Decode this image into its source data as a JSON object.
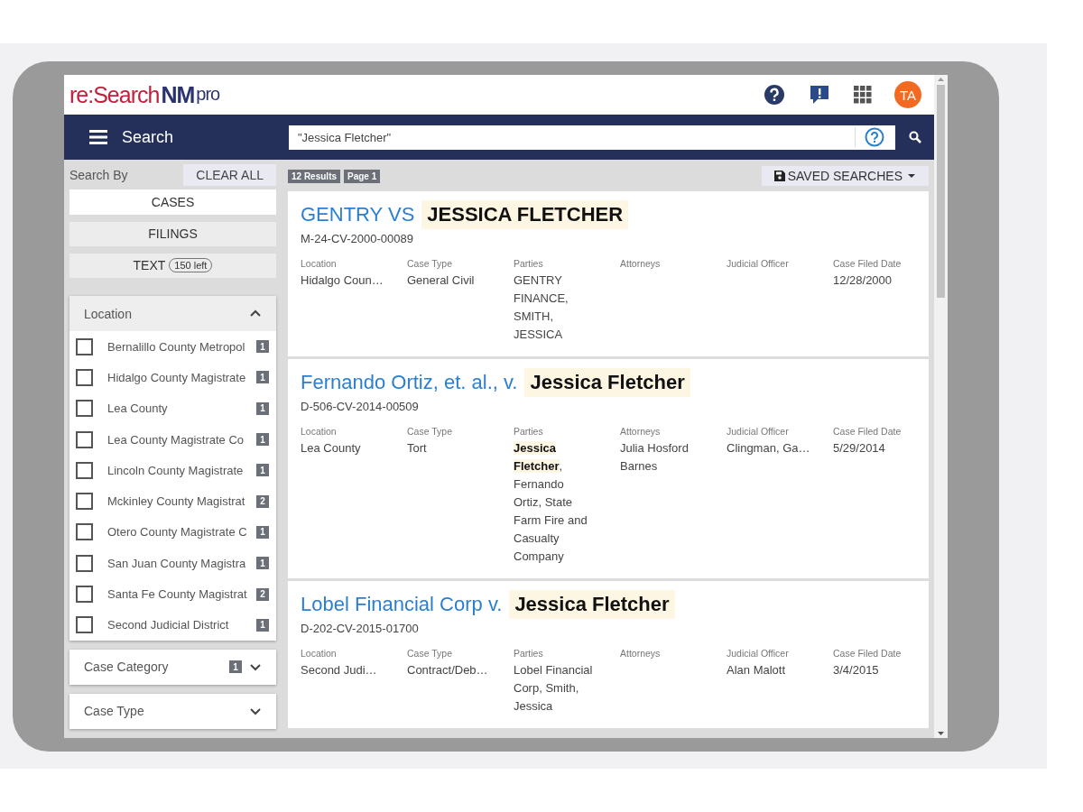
{
  "logo": {
    "part_1": "re:Search",
    "part_2": "NM",
    "part_3": "pro"
  },
  "header": {
    "avatar": "TA"
  },
  "nav": {
    "menu_label": "Search",
    "search": {
      "value": "\"Jessica Fletcher\""
    }
  },
  "sidebar": {
    "search_by_label": "Search By",
    "clear_all": "CLEAR ALL",
    "modes": [
      {
        "label": "CASES",
        "selected": true
      },
      {
        "label": "FILINGS",
        "selected": false
      },
      {
        "label": "TEXT",
        "badge": "150 left",
        "selected": false
      }
    ],
    "filters": [
      {
        "title": "Location",
        "expanded": true,
        "options": [
          {
            "label": "Bernalillo County Metropol",
            "count": "1",
            "checked": false
          },
          {
            "label": "Hidalgo County Magistrate",
            "count": "1",
            "checked": false
          },
          {
            "label": "Lea County",
            "count": "1",
            "checked": false
          },
          {
            "label": "Lea County Magistrate Co",
            "count": "1",
            "checked": false
          },
          {
            "label": "Lincoln County Magistrate",
            "count": "1",
            "checked": false
          },
          {
            "label": "Mckinley County Magistrat",
            "count": "2",
            "checked": false
          },
          {
            "label": "Otero County Magistrate C",
            "count": "1",
            "checked": false
          },
          {
            "label": "San Juan County Magistra",
            "count": "1",
            "checked": false
          },
          {
            "label": "Santa Fe County Magistrat",
            "count": "2",
            "checked": false
          },
          {
            "label": "Second Judicial District",
            "count": "1",
            "checked": false
          }
        ]
      },
      {
        "title": "Case Category",
        "count": "1",
        "expanded": false
      },
      {
        "title": "Case Type",
        "expanded": false
      }
    ]
  },
  "results": {
    "count_badge": "12 Results",
    "page_badge": "Page 1",
    "saved_searches": "SAVED SEARCHES",
    "cases": [
      {
        "title_prefix": "GENTRY VS",
        "title_match": "JESSICA FLETCHER",
        "number": "M-24-CV-2000-00089",
        "fields": [
          {
            "label": "Location",
            "value": "Hidalgo Coun…"
          },
          {
            "label": "Case Type",
            "value": "General Civil"
          },
          {
            "label": "Parties",
            "value": "GENTRY FINANCE, SMITH, JESSICA"
          },
          {
            "label": "Attorneys"
          },
          {
            "label": "Judicial Officer"
          },
          {
            "label": "Case Filed Date",
            "value": "12/28/2000"
          }
        ]
      },
      {
        "title_prefix": "Fernando Ortiz, et. al., v.",
        "title_match": "Jessica Fletcher",
        "number": "D-506-CV-2014-00509",
        "fields": [
          {
            "label": "Location",
            "value": "Lea County"
          },
          {
            "label": "Case Type",
            "value": "Tort"
          },
          {
            "label": "Parties",
            "value": "**Jessica Fletcher**, Fernando Ortiz, State Farm Fire and Casualty Company"
          },
          {
            "label": "Attorneys",
            "value": "Julia Hosford Barnes"
          },
          {
            "label": "Judicial Officer",
            "value": "Clingman, Ga…"
          },
          {
            "label": "Case Filed Date",
            "value": "5/29/2014"
          }
        ]
      },
      {
        "title_prefix": "Lobel Financial Corp v.",
        "title_match": "Jessica Fletcher",
        "number": "D-202-CV-2015-01700",
        "fields": [
          {
            "label": "Location",
            "value": "Second Judi…"
          },
          {
            "label": "Case Type",
            "value": "Contract/Deb…"
          },
          {
            "label": "Parties",
            "value": "Lobel Financial Corp, Smith, Jessica"
          },
          {
            "label": "Attorneys"
          },
          {
            "label": "Judicial Officer",
            "value": "Alan Malott"
          },
          {
            "label": "Case Filed Date",
            "value": "3/4/2015"
          }
        ]
      }
    ]
  }
}
